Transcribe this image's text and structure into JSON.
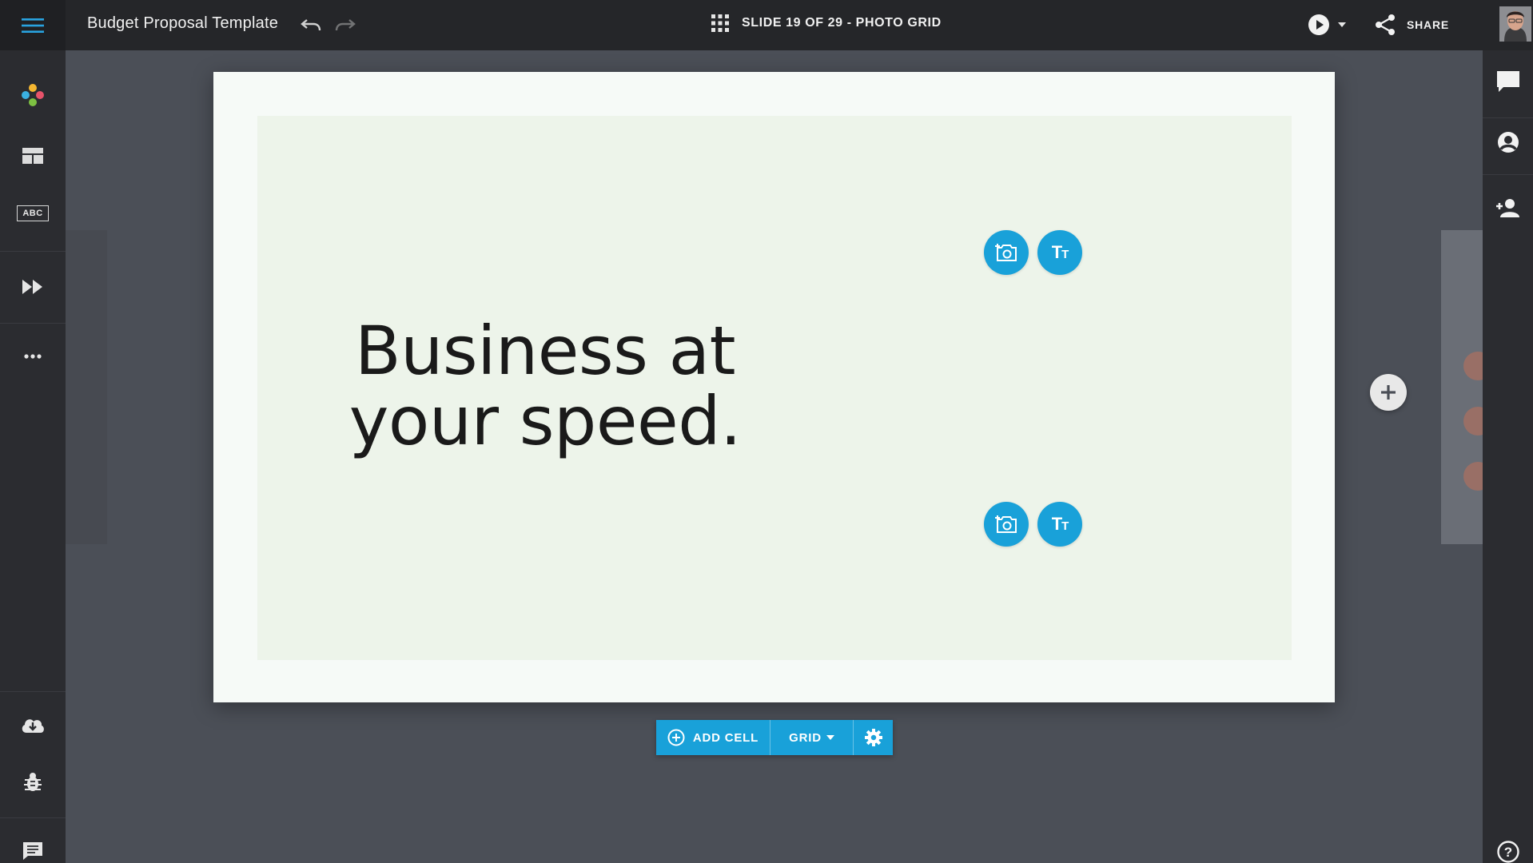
{
  "topbar": {
    "title": "Budget Proposal Template",
    "slide_indicator": "SLIDE 19 OF 29 - PHOTO GRID",
    "share_label": "SHARE"
  },
  "left_sidebar": {
    "items": [
      {
        "icon": "logo-dots-icon"
      },
      {
        "icon": "layout-icon"
      },
      {
        "icon": "text-styles-icon",
        "label": "ABC"
      },
      {
        "icon": "fast-forward-icon"
      },
      {
        "icon": "more-icon"
      },
      {
        "icon": "cloud-download-icon"
      },
      {
        "icon": "bug-icon"
      },
      {
        "icon": "notes-icon"
      }
    ]
  },
  "right_sidebar": {
    "items": [
      {
        "icon": "comment-icon"
      },
      {
        "icon": "account-icon"
      },
      {
        "icon": "add-person-icon"
      },
      {
        "icon": "help-icon",
        "label": "?"
      }
    ]
  },
  "slide": {
    "headline_line1": "Business at",
    "headline_line2": "your speed.",
    "background": "#edf4ea"
  },
  "bottom_toolbar": {
    "add_cell_label": "ADD CELL",
    "grid_label": "GRID"
  },
  "colors": {
    "accent": "#19a1d9",
    "topbar": "#252629",
    "canvas": "#4b4f57"
  }
}
